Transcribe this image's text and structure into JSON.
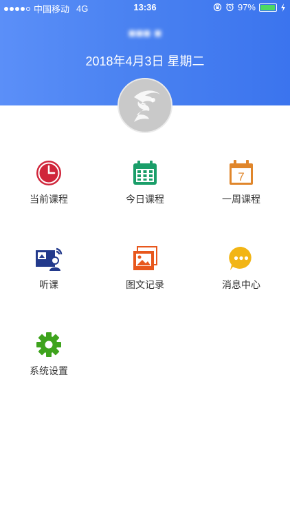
{
  "status": {
    "carrier": "中国移动",
    "network": "4G",
    "time": "13:36",
    "battery": "97%",
    "battery_level": 0.97
  },
  "header": {
    "user_name": "■■■ ■",
    "date": "2018年4月3日  星期二"
  },
  "menu": [
    {
      "label": "当前课程",
      "icon": "clock-icon",
      "color": "#d0253a"
    },
    {
      "label": "今日课程",
      "icon": "calendar-grid-icon",
      "color": "#1a9e69"
    },
    {
      "label": "一周课程",
      "icon": "calendar-week-icon",
      "color": "#e0862b"
    },
    {
      "label": "听课",
      "icon": "lecture-icon",
      "color": "#233a8c"
    },
    {
      "label": "图文记录",
      "icon": "photo-notes-icon",
      "color": "#e8571c"
    },
    {
      "label": "消息中心",
      "icon": "message-icon",
      "color": "#f2b515"
    },
    {
      "label": "系统设置",
      "icon": "gear-icon",
      "color": "#3ea31d"
    }
  ],
  "calendar_week_day": "7"
}
